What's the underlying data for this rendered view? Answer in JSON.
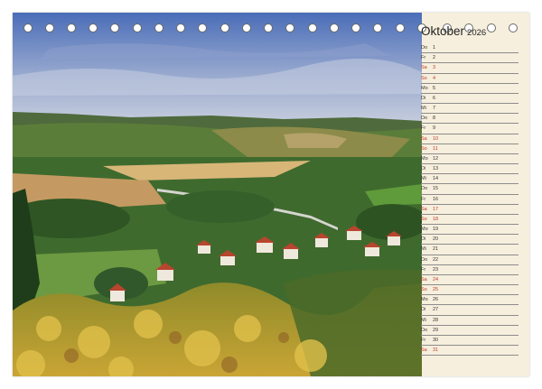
{
  "calendar": {
    "month": "Oktober",
    "year": "2026",
    "days": [
      {
        "dow": "Do",
        "num": "1",
        "weekend": false
      },
      {
        "dow": "Fr",
        "num": "2",
        "weekend": false
      },
      {
        "dow": "Sa",
        "num": "3",
        "weekend": true
      },
      {
        "dow": "So",
        "num": "4",
        "weekend": true
      },
      {
        "dow": "Mo",
        "num": "5",
        "weekend": false
      },
      {
        "dow": "Di",
        "num": "6",
        "weekend": false
      },
      {
        "dow": "Mi",
        "num": "7",
        "weekend": false
      },
      {
        "dow": "Do",
        "num": "8",
        "weekend": false
      },
      {
        "dow": "Fr",
        "num": "9",
        "weekend": false
      },
      {
        "dow": "Sa",
        "num": "10",
        "weekend": true
      },
      {
        "dow": "So",
        "num": "11",
        "weekend": true
      },
      {
        "dow": "Mo",
        "num": "12",
        "weekend": false
      },
      {
        "dow": "Di",
        "num": "13",
        "weekend": false
      },
      {
        "dow": "Mi",
        "num": "14",
        "weekend": false
      },
      {
        "dow": "Do",
        "num": "15",
        "weekend": false
      },
      {
        "dow": "Fr",
        "num": "16",
        "weekend": false
      },
      {
        "dow": "Sa",
        "num": "17",
        "weekend": true
      },
      {
        "dow": "So",
        "num": "18",
        "weekend": true
      },
      {
        "dow": "Mo",
        "num": "19",
        "weekend": false
      },
      {
        "dow": "Di",
        "num": "20",
        "weekend": false
      },
      {
        "dow": "Mi",
        "num": "21",
        "weekend": false
      },
      {
        "dow": "Do",
        "num": "22",
        "weekend": false
      },
      {
        "dow": "Fr",
        "num": "23",
        "weekend": false
      },
      {
        "dow": "Sa",
        "num": "24",
        "weekend": true
      },
      {
        "dow": "So",
        "num": "25",
        "weekend": true
      },
      {
        "dow": "Mo",
        "num": "26",
        "weekend": false
      },
      {
        "dow": "Di",
        "num": "27",
        "weekend": false
      },
      {
        "dow": "Mi",
        "num": "28",
        "weekend": false
      },
      {
        "dow": "Do",
        "num": "29",
        "weekend": false
      },
      {
        "dow": "Fr",
        "num": "30",
        "weekend": false
      },
      {
        "dow": "Sa",
        "num": "31",
        "weekend": true
      }
    ]
  },
  "colors": {
    "panel": "#f6efdd",
    "weekend_text": "#c0392b",
    "weekday_text": "#333333",
    "sky_top": "#4a6db8",
    "field": "#d8b678",
    "foliage": "#c9a535"
  }
}
